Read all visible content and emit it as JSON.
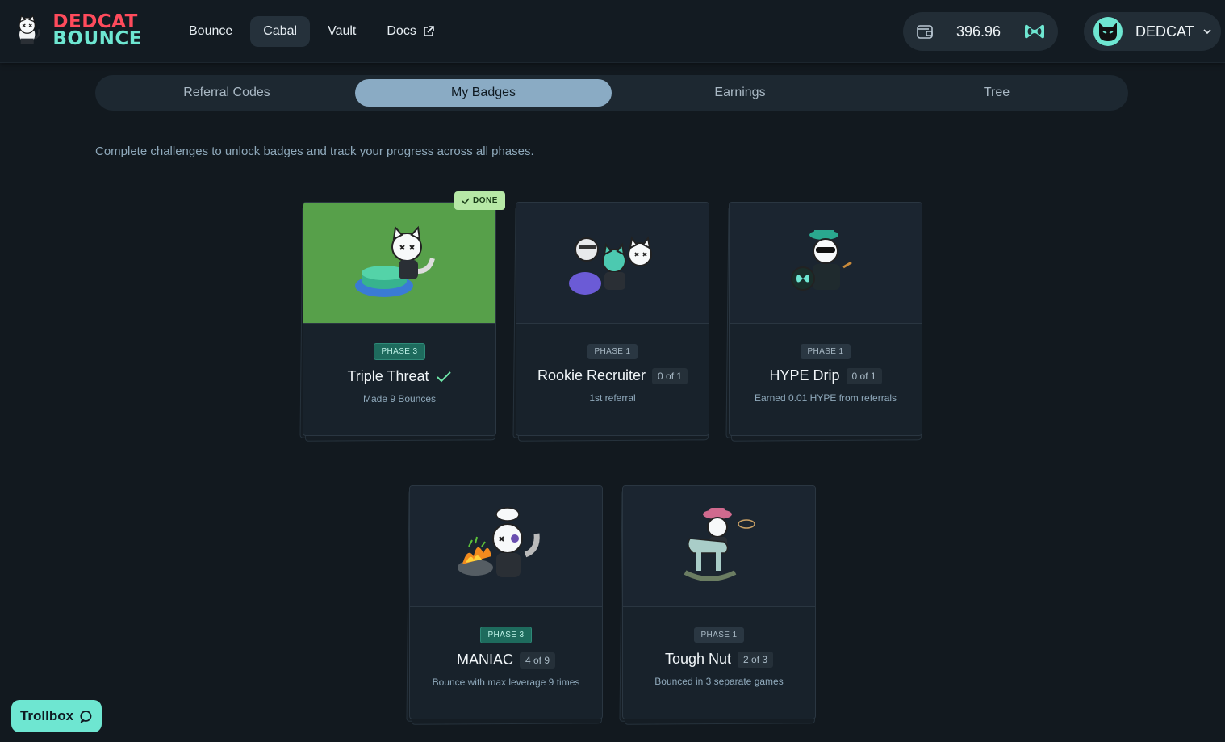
{
  "logo": {
    "line1": "DEDCAT",
    "line2": "BOUNCE"
  },
  "nav": {
    "items": [
      {
        "label": "Bounce"
      },
      {
        "label": "Cabal",
        "active": true
      },
      {
        "label": "Vault"
      },
      {
        "label": "Docs",
        "external": true
      }
    ]
  },
  "wallet": {
    "balance": "396.96",
    "icon": "wallet-icon",
    "token_icon": "hype-token-icon"
  },
  "user": {
    "name": "DEDCAT",
    "avatar": "cat-avatar-icon"
  },
  "tabs": [
    {
      "label": "Referral Codes"
    },
    {
      "label": "My Badges",
      "active": true
    },
    {
      "label": "Earnings"
    },
    {
      "label": "Tree"
    }
  ],
  "intro": "Complete challenges to unlock badges and track your progress across all phases.",
  "done_label": "DONE",
  "badges": [
    {
      "phase": "PHASE 3",
      "title": "Triple Threat",
      "count": "",
      "desc": "Made 9 Bounces",
      "done": true
    },
    {
      "phase": "PHASE 1",
      "title": "Rookie Recruiter",
      "count": "0 of 1",
      "desc": "1st referral",
      "done": false
    },
    {
      "phase": "PHASE 1",
      "title": "HYPE Drip",
      "count": "0 of 1",
      "desc": "Earned 0.01 HYPE from referrals",
      "done": false
    },
    {
      "phase": "PHASE 3",
      "title": "MANIAC",
      "count": "4 of 9",
      "desc": "Bounce with max leverage 9 times",
      "done": false
    },
    {
      "phase": "PHASE 1",
      "title": "Tough Nut",
      "count": "2 of 3",
      "desc": "Bounced in 3 separate games",
      "done": false
    }
  ],
  "trollbox": {
    "label": "Trollbox"
  },
  "colors": {
    "accent": "#6ee6d1",
    "brand_red": "#ff4b5c",
    "done_green": "#57a04a",
    "background": "#12191f"
  }
}
